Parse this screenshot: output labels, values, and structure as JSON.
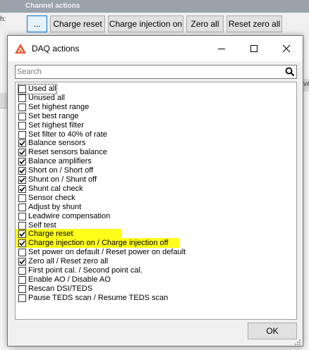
{
  "background": {
    "section_title": "Channel actions",
    "side_label": "h:",
    "right_label": "ve",
    "buttons": [
      "...",
      "Charge reset",
      "Charge injection on",
      "Zero all",
      "Reset zero all"
    ]
  },
  "dialog": {
    "title": "DAQ actions",
    "search_placeholder": "Search",
    "ok_label": "OK",
    "highlight_color": "#ffff1a",
    "items": [
      {
        "label": "Used all",
        "checked": false
      },
      {
        "label": "Unused all",
        "checked": false
      },
      {
        "label": "Set highest range",
        "checked": false
      },
      {
        "label": "Set best range",
        "checked": false
      },
      {
        "label": "Set highest filter",
        "checked": false
      },
      {
        "label": "Set filter to 40% of rate",
        "checked": false
      },
      {
        "label": "Balance sensors",
        "checked": true
      },
      {
        "label": "Reset sensors balance",
        "checked": true
      },
      {
        "label": "Balance amplifiers",
        "checked": true
      },
      {
        "label": "Short on / Short off",
        "checked": true
      },
      {
        "label": "Shunt on / Shunt off",
        "checked": true
      },
      {
        "label": "Shunt cal check",
        "checked": true
      },
      {
        "label": "Sensor check",
        "checked": false
      },
      {
        "label": "Adjust by shunt",
        "checked": false
      },
      {
        "label": "Leadwire compensation",
        "checked": false
      },
      {
        "label": "Self test",
        "checked": false
      },
      {
        "label": "Charge reset",
        "checked": true
      },
      {
        "label": "Charge injection on / Charge injection off",
        "checked": true
      },
      {
        "label": "Set power on default / Reset power on default",
        "checked": false
      },
      {
        "label": "Zero all / Reset zero all",
        "checked": true
      },
      {
        "label": "First point cal. / Second point cal.",
        "checked": false
      },
      {
        "label": "Enable AO / Disable AO",
        "checked": false
      },
      {
        "label": "Rescan DSI/TEDS",
        "checked": false
      },
      {
        "label": "Pause TEDS scan / Resume TEDS scan",
        "checked": false
      }
    ]
  }
}
